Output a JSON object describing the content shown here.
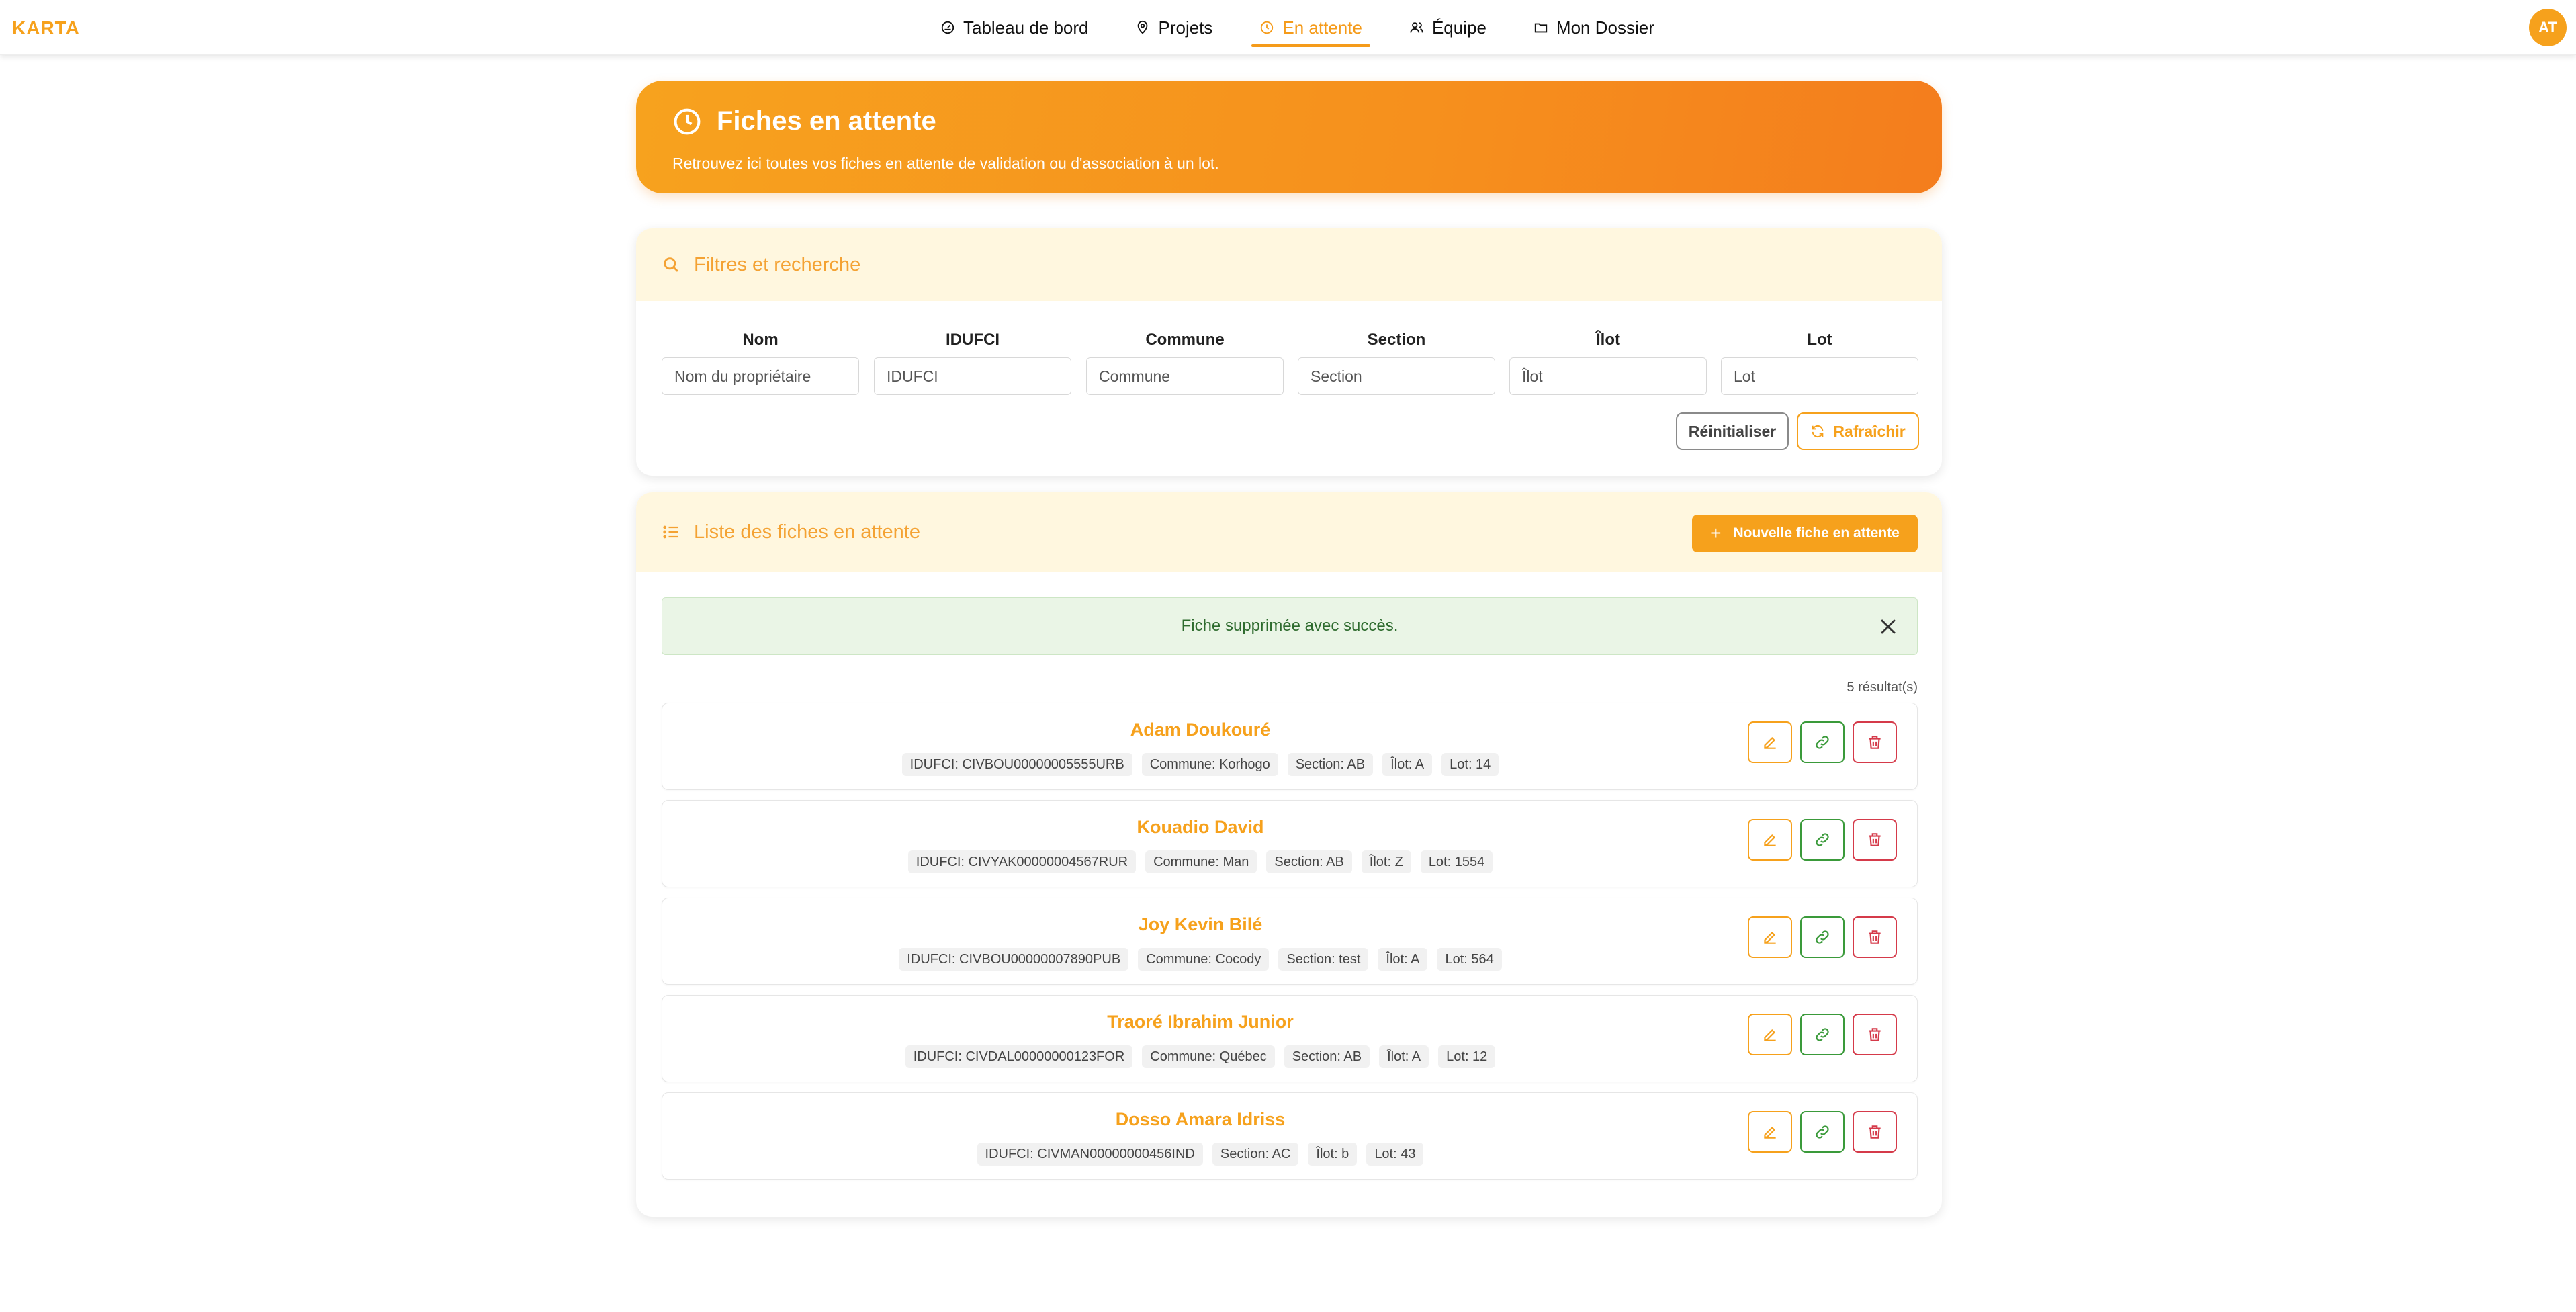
{
  "app": {
    "logo_text": "KARTA",
    "avatar_initials": "AT"
  },
  "nav": {
    "items": [
      {
        "label": "Tableau de bord",
        "icon": "dashboard-icon"
      },
      {
        "label": "Projets",
        "icon": "map-pin-icon"
      },
      {
        "label": "En attente",
        "icon": "clock-icon",
        "active": true
      },
      {
        "label": "Équipe",
        "icon": "users-icon"
      },
      {
        "label": "Mon Dossier",
        "icon": "folder-icon"
      }
    ]
  },
  "hero": {
    "title": "Fiches en attente",
    "subtitle": "Retrouvez ici toutes vos fiches en attente de validation ou d'association à un lot."
  },
  "filters": {
    "title": "Filtres et recherche",
    "fields": [
      {
        "label": "Nom",
        "placeholder": "Nom du propriétaire",
        "value": ""
      },
      {
        "label": "IDUFCI",
        "placeholder": "IDUFCI",
        "value": ""
      },
      {
        "label": "Commune",
        "placeholder": "Commune",
        "value": ""
      },
      {
        "label": "Section",
        "placeholder": "Section",
        "value": ""
      },
      {
        "label": "Îlot",
        "placeholder": "Îlot",
        "value": ""
      },
      {
        "label": "Lot",
        "placeholder": "Lot",
        "value": ""
      }
    ],
    "reset_label": "Réinitialiser",
    "refresh_label": "Rafraîchir"
  },
  "list": {
    "title": "Liste des fiches en attente",
    "new_label": "Nouvelle fiche en attente",
    "alert_text": "Fiche supprimée avec succès.",
    "count_text": "5 résultat(s)",
    "rows": [
      {
        "name": "Adam Doukouré",
        "tags": [
          "IDUFCI: CIVBOU00000005555URB",
          "Commune: Korhogo",
          "Section: AB",
          "Îlot: A",
          "Lot: 14"
        ]
      },
      {
        "name": "Kouadio David",
        "tags": [
          "IDUFCI: CIVYAK00000004567RUR",
          "Commune: Man",
          "Section: AB",
          "Îlot: Z",
          "Lot: 1554"
        ]
      },
      {
        "name": "Joy Kevin Bilé",
        "tags": [
          "IDUFCI: CIVBOU00000007890PUB",
          "Commune: Cocody",
          "Section: test",
          "Îlot: A",
          "Lot: 564"
        ]
      },
      {
        "name": "Traoré Ibrahim Junior",
        "tags": [
          "IDUFCI: CIVDAL00000000123FOR",
          "Commune: Québec",
          "Section: AB",
          "Îlot: A",
          "Lot: 12"
        ]
      },
      {
        "name": "Dosso Amara Idriss",
        "tags": [
          "IDUFCI: CIVMAN00000000456IND",
          "Section: AC",
          "Îlot: b",
          "Lot: 43"
        ]
      }
    ]
  },
  "colors": {
    "accent": "#f6a11c",
    "success": "#3a9a3a",
    "danger": "#d53a4a"
  }
}
